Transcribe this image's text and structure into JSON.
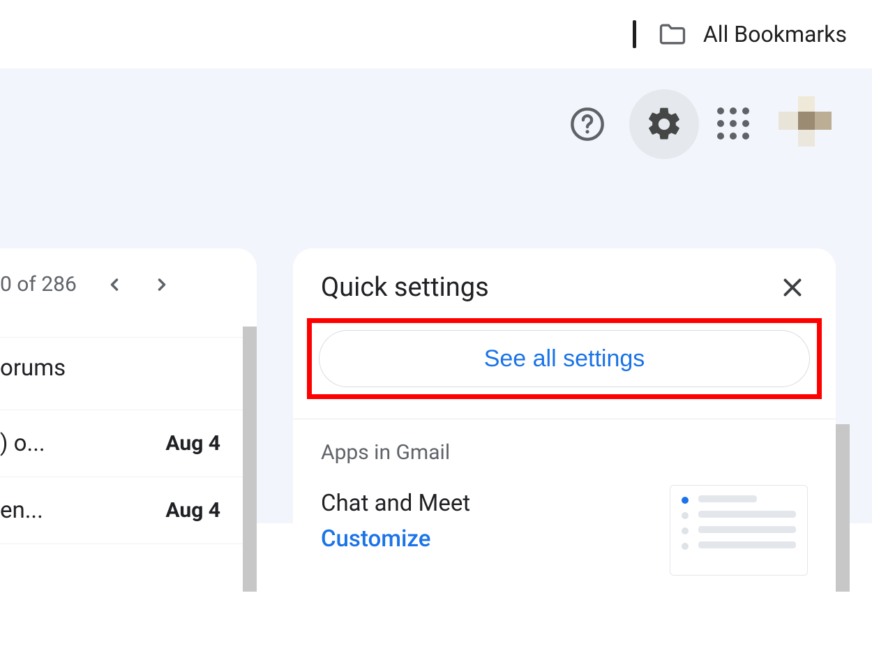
{
  "browser": {
    "all_bookmarks_label": "All Bookmarks"
  },
  "topbar": {
    "help_icon": "help-icon",
    "settings_icon": "gear-icon",
    "apps_icon": "apps-grid-icon"
  },
  "inbox": {
    "pager_text": "0 of 286",
    "category_label": "orums",
    "rows": [
      {
        "subject": ") o...",
        "date": "Aug 4"
      },
      {
        "subject": "en...",
        "date": "Aug 4"
      }
    ]
  },
  "quick_settings": {
    "title": "Quick settings",
    "see_all_label": "See all settings",
    "section_label": "Apps in Gmail",
    "option_title": "Chat and Meet",
    "option_link": "Customize"
  }
}
